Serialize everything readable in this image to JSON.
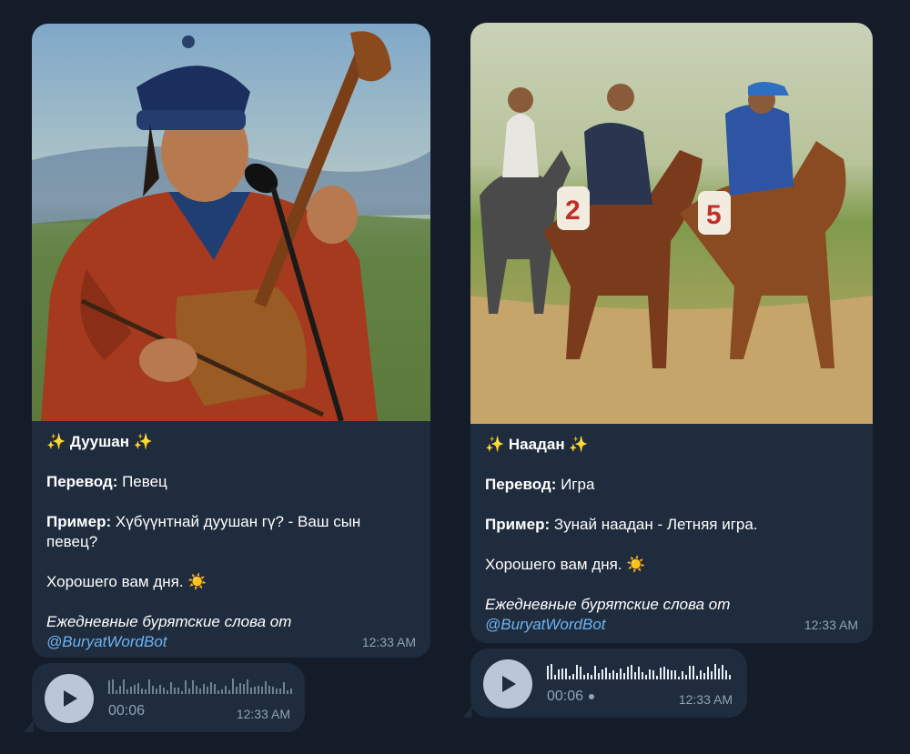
{
  "messages": [
    {
      "title": "Дуушан",
      "translation_label": "Перевод:",
      "translation_value": " Певец",
      "example_label": "Пример:",
      "example_value": " Хүбүүнтнай дуушан гү? - Ваш сын певец?",
      "greeting": "Хорошего вам дня.",
      "footer": "Ежедневные бурятские слова от",
      "link": "@BuryatWordBot",
      "time": "12:33 AM",
      "image_alt": "Painting of a Buryat singer playing a horsehead fiddle"
    },
    {
      "title": "Наадан",
      "translation_label": "Перевод:",
      "translation_value": " Игра",
      "example_label": "Пример:",
      "example_value": " Зунай наадан - Летняя игра.",
      "greeting": "Хорошего вам дня.",
      "footer": "Ежедневные бурятские слова от",
      "link": "@BuryatWordBot",
      "time": "12:33 AM",
      "image_alt": "Painting of children racing horses on the steppe"
    }
  ],
  "voices": [
    {
      "duration": "00:06",
      "time": "12:33 AM"
    },
    {
      "duration": "00:06",
      "time": "12:33 AM",
      "unplayed": true
    }
  ],
  "icons": {
    "sparkle": "✨",
    "sun": "☀️"
  },
  "colors": {
    "background": "#131c28",
    "bubble": "#1f2c3d",
    "link": "#6db3f2",
    "meta": "#8fa2b6"
  }
}
